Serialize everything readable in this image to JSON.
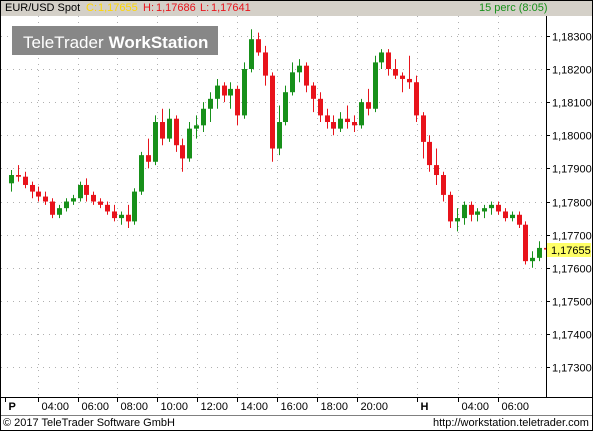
{
  "header": {
    "symbol": "EUR/USD Spot",
    "close_label": "C:",
    "close_value": "1,17655",
    "high_label": "H:",
    "high_value": "1,17686",
    "low_label": "L:",
    "low_value": "1,17641",
    "interval": "15 perc (8:05)"
  },
  "logo": {
    "part1": "TeleTrader",
    "part2": "WorkStation"
  },
  "footer": {
    "copyright": "© 2017  TeleTrader Software GmbH",
    "url": "http://workstation.teletrader.com"
  },
  "colors": {
    "up": "#17901a",
    "down": "#e8131b",
    "close_value": "#ffd700",
    "high_value": "#e8131b",
    "low_value": "#e8131b",
    "interval": "#17901a",
    "price_marker": "#ffff66"
  },
  "chart_data": {
    "type": "candlestick",
    "x_ticks": [
      "P",
      "04:00",
      "06:00",
      "08:00",
      "10:00",
      "12:00",
      "14:00",
      "16:00",
      "18:00",
      "20:00",
      "H",
      "04:00",
      "06:00"
    ],
    "y_ticks": [
      "1,17300",
      "1,17400",
      "1,17500",
      "1,17600",
      "1,17700",
      "1,17800",
      "1,17900",
      "1,18000",
      "1,18100",
      "1,18200",
      "1,18300"
    ],
    "ylim": [
      1.1721,
      1.1836
    ],
    "current_price": 1.17655,
    "current_price_label": "1,17655",
    "grid": true,
    "candles": [
      [
        1.17855,
        1.17895,
        1.1783,
        1.1788
      ],
      [
        1.1788,
        1.1791,
        1.1786,
        1.17875
      ],
      [
        1.17875,
        1.1789,
        1.1784,
        1.1785
      ],
      [
        1.1785,
        1.1786,
        1.1781,
        1.1783
      ],
      [
        1.1783,
        1.17845,
        1.178,
        1.17815
      ],
      [
        1.17815,
        1.1783,
        1.1779,
        1.178
      ],
      [
        1.178,
        1.1781,
        1.1775,
        1.1776
      ],
      [
        1.1776,
        1.1779,
        1.1775,
        1.1778
      ],
      [
        1.1778,
        1.1781,
        1.1777,
        1.178
      ],
      [
        1.178,
        1.1782,
        1.1779,
        1.1781
      ],
      [
        1.1781,
        1.1786,
        1.178,
        1.1785
      ],
      [
        1.1785,
        1.1787,
        1.178,
        1.1782
      ],
      [
        1.1782,
        1.1783,
        1.1779,
        1.178
      ],
      [
        1.178,
        1.1781,
        1.1778,
        1.1779
      ],
      [
        1.1779,
        1.178,
        1.1776,
        1.1777
      ],
      [
        1.1777,
        1.1779,
        1.1774,
        1.1775
      ],
      [
        1.1775,
        1.1777,
        1.1773,
        1.1776
      ],
      [
        1.1776,
        1.1779,
        1.1772,
        1.1774
      ],
      [
        1.1774,
        1.1784,
        1.1773,
        1.1783
      ],
      [
        1.1783,
        1.1795,
        1.1782,
        1.1794
      ],
      [
        1.1794,
        1.1799,
        1.179,
        1.1792
      ],
      [
        1.1792,
        1.1806,
        1.1791,
        1.1804
      ],
      [
        1.1804,
        1.1808,
        1.1797,
        1.1799
      ],
      [
        1.1799,
        1.1808,
        1.1798,
        1.1805
      ],
      [
        1.1805,
        1.1806,
        1.1795,
        1.1797
      ],
      [
        1.1797,
        1.1799,
        1.1789,
        1.1793
      ],
      [
        1.1793,
        1.1804,
        1.1792,
        1.1802
      ],
      [
        1.1802,
        1.1806,
        1.1799,
        1.1803
      ],
      [
        1.1803,
        1.181,
        1.1801,
        1.1808
      ],
      [
        1.1808,
        1.1813,
        1.1804,
        1.1811
      ],
      [
        1.1811,
        1.1817,
        1.1808,
        1.1815
      ],
      [
        1.1815,
        1.1816,
        1.181,
        1.1812
      ],
      [
        1.1812,
        1.1816,
        1.1808,
        1.1814
      ],
      [
        1.1814,
        1.1815,
        1.1803,
        1.1806
      ],
      [
        1.1806,
        1.1822,
        1.1805,
        1.182
      ],
      [
        1.182,
        1.1832,
        1.1819,
        1.1829
      ],
      [
        1.1829,
        1.1831,
        1.1824,
        1.1825
      ],
      [
        1.1825,
        1.1827,
        1.1815,
        1.1818
      ],
      [
        1.1818,
        1.1819,
        1.1792,
        1.1796
      ],
      [
        1.1796,
        1.1809,
        1.1794,
        1.1804
      ],
      [
        1.1804,
        1.1815,
        1.1803,
        1.1813
      ],
      [
        1.1813,
        1.1822,
        1.1812,
        1.1819
      ],
      [
        1.1819,
        1.1823,
        1.1816,
        1.1821
      ],
      [
        1.1821,
        1.1822,
        1.1813,
        1.1815
      ],
      [
        1.1815,
        1.1816,
        1.1807,
        1.1811
      ],
      [
        1.1811,
        1.1813,
        1.1804,
        1.1806
      ],
      [
        1.1806,
        1.1808,
        1.1802,
        1.1804
      ],
      [
        1.1804,
        1.1806,
        1.18,
        1.1802
      ],
      [
        1.1802,
        1.1807,
        1.1801,
        1.1805
      ],
      [
        1.1805,
        1.1809,
        1.1802,
        1.1804
      ],
      [
        1.1804,
        1.1806,
        1.1801,
        1.1803
      ],
      [
        1.1803,
        1.1811,
        1.1802,
        1.181
      ],
      [
        1.181,
        1.1814,
        1.1806,
        1.1808
      ],
      [
        1.1808,
        1.1824,
        1.1807,
        1.1822
      ],
      [
        1.1822,
        1.1826,
        1.182,
        1.1825
      ],
      [
        1.1825,
        1.1826,
        1.1818,
        1.182
      ],
      [
        1.182,
        1.1823,
        1.1817,
        1.1818
      ],
      [
        1.1818,
        1.1819,
        1.1813,
        1.1817
      ],
      [
        1.1817,
        1.1824,
        1.1814,
        1.1816
      ],
      [
        1.1816,
        1.1818,
        1.1804,
        1.1806
      ],
      [
        1.1806,
        1.1807,
        1.1793,
        1.1798
      ],
      [
        1.1798,
        1.18,
        1.1789,
        1.1791
      ],
      [
        1.1791,
        1.1796,
        1.1785,
        1.1788
      ],
      [
        1.1788,
        1.1789,
        1.178,
        1.1782
      ],
      [
        1.1782,
        1.1783,
        1.1772,
        1.1774
      ],
      [
        1.1774,
        1.1778,
        1.1771,
        1.1775
      ],
      [
        1.1775,
        1.178,
        1.1773,
        1.1779
      ],
      [
        1.1779,
        1.178,
        1.1774,
        1.1776
      ],
      [
        1.1776,
        1.1778,
        1.1774,
        1.1777
      ],
      [
        1.1777,
        1.1779,
        1.1775,
        1.1778
      ],
      [
        1.1778,
        1.178,
        1.1776,
        1.1779
      ],
      [
        1.1779,
        1.178,
        1.1776,
        1.1777
      ],
      [
        1.1777,
        1.1778,
        1.1774,
        1.1775
      ],
      [
        1.1775,
        1.1777,
        1.1774,
        1.1776
      ],
      [
        1.1776,
        1.1777,
        1.1772,
        1.1773
      ],
      [
        1.1773,
        1.1774,
        1.1761,
        1.1762
      ],
      [
        1.1762,
        1.1765,
        1.176,
        1.1763
      ],
      [
        1.1763,
        1.1768,
        1.1762,
        1.1766
      ],
      [
        1.1766,
        1.17686,
        1.17641,
        1.17655
      ]
    ]
  }
}
